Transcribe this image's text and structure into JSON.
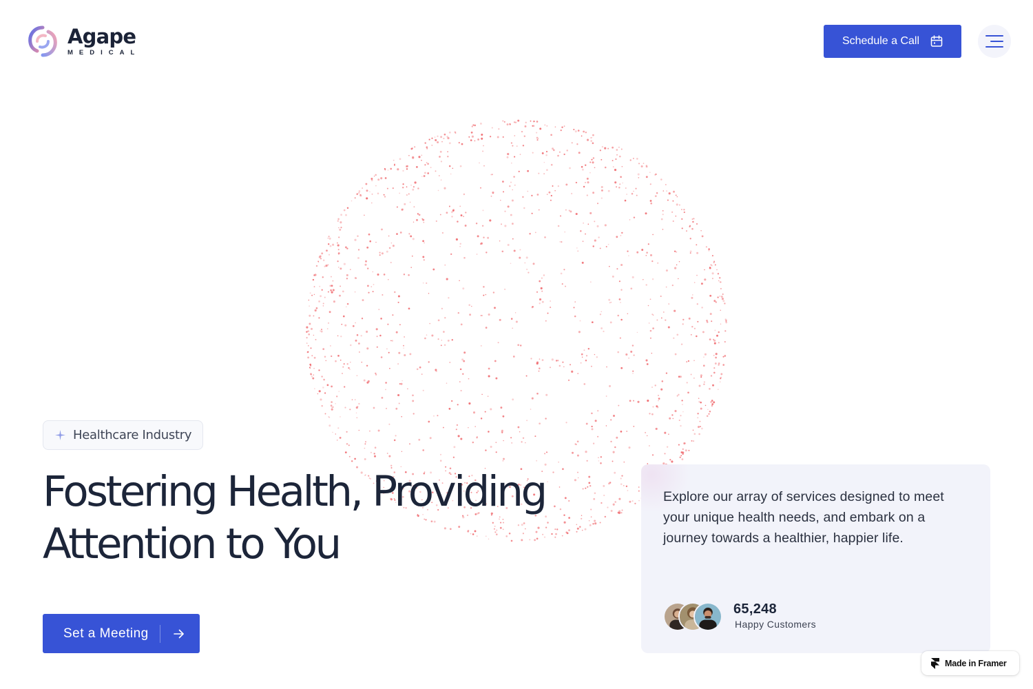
{
  "brand": {
    "name": "Agape",
    "sub": "MEDICAL"
  },
  "header": {
    "schedule_label": "Schedule a Call"
  },
  "hero": {
    "badge": "Healthcare Industry",
    "title_line1": "Fostering Health, Providing",
    "title_line2": "Attention to You",
    "cta_label": "Set a Meeting"
  },
  "card": {
    "text": "Explore our array of services designed to meet your unique health needs, and embark on a journey towards a healthier, happier life.",
    "count": "65,248",
    "count_label": "Happy Customers"
  },
  "framer": {
    "label": "Made in Framer"
  },
  "colors": {
    "accent": "#3753d6",
    "text": "#1c2539",
    "card_bg": "#f2f3fa",
    "dots": "#ee5d62"
  }
}
